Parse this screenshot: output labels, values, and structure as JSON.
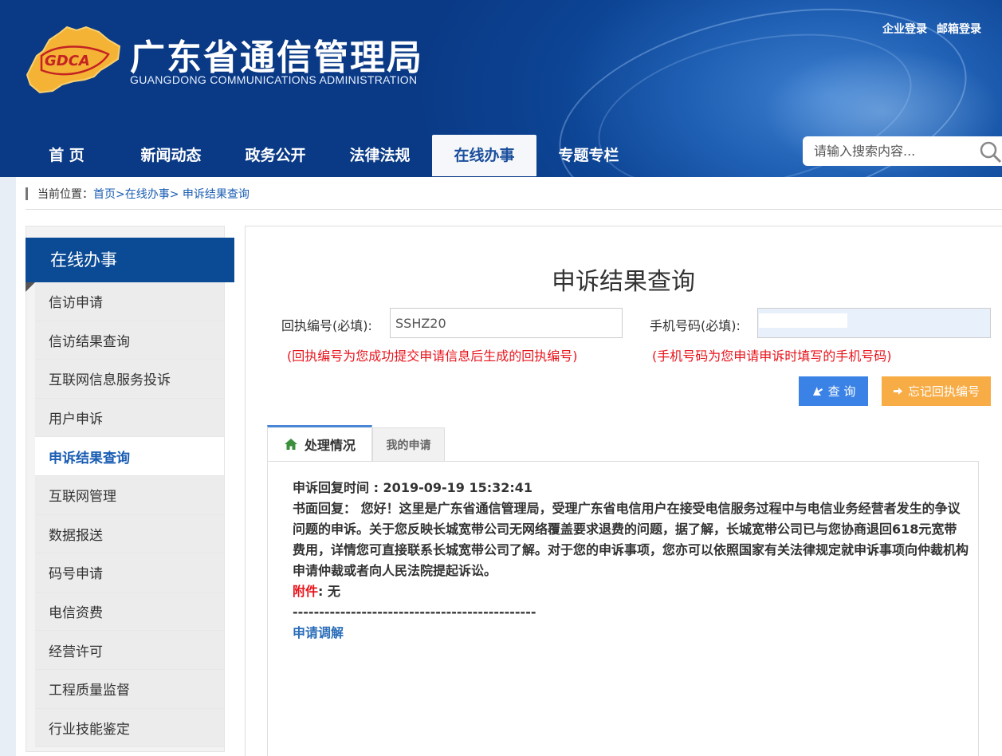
{
  "header": {
    "title": "广东省通信管理局",
    "subtitle": "GUANGDONG COMMUNICATIONS ADMINISTRATION",
    "logo_text": "GDCA",
    "top_links": [
      "企业登录",
      "邮箱登录"
    ]
  },
  "nav": {
    "items": [
      "首 页",
      "新闻动态",
      "政务公开",
      "法律法规",
      "在线办事",
      "专题专栏"
    ],
    "active": "在线办事"
  },
  "search": {
    "placeholder": "请输入搜索内容..."
  },
  "breadcrumb": {
    "label": "当前位置：",
    "path": "首页>在线办事> 申诉结果查询"
  },
  "sidebar": {
    "title": "在线办事",
    "items": [
      "信访申请",
      "信访结果查询",
      "互联网信息服务投诉",
      "用户申诉",
      "申诉结果查询",
      "互联网管理",
      "数据报送",
      "码号申请",
      "电信资费",
      "经营许可",
      "工程质量监督",
      "行业技能鉴定"
    ],
    "active": "申诉结果查询"
  },
  "main": {
    "title": "申诉结果查询",
    "receipt_label": "回执编号(必填):",
    "receipt_value": "SSHZ20",
    "phone_label": "手机号码(必填):",
    "phone_value": "",
    "receipt_hint": "(回执编号为您成功提交申请信息后生成的回执编号)",
    "phone_hint": "(手机号码为您申请申诉时填写的手机号码)",
    "query_button": "查 询",
    "forget_button": "忘记回执编号"
  },
  "tabs": {
    "items": [
      "处理情况",
      "我的申请"
    ],
    "active": "处理情况"
  },
  "result": {
    "reply_time_label": "申诉回复时间 : ",
    "reply_time": "2019-09-19 15:32:41",
    "written_reply_label": "书面回复： ",
    "written_reply": "您好！这里是广东省通信管理局，受理广东省电信用户在接受电信服务过程中与电信业务经营者发生的争议问题的申诉。关于您反映长城宽带公司无网络覆盖要求退费的问题，据了解，长城宽带公司已与您协商退回618元宽带费用，详情您可直接联系长城宽带公司了解。对于您的申诉事项，您亦可以依照国家有关法律规定就申诉事项向仲裁机构申请仲裁或者向人民法院提起诉讼。",
    "attachment_label": "附件",
    "attachment_value": ": 无",
    "divider": "----------------------------------------------",
    "mediation_link": "申请调解"
  },
  "colors": {
    "header_blue": "#0a3a86",
    "sidebar_head": "#0b4a94",
    "link_blue": "#1a5db3",
    "hint_red": "#e8141c",
    "query_btn": "#3b82e6",
    "forget_btn": "#f7ac45"
  }
}
